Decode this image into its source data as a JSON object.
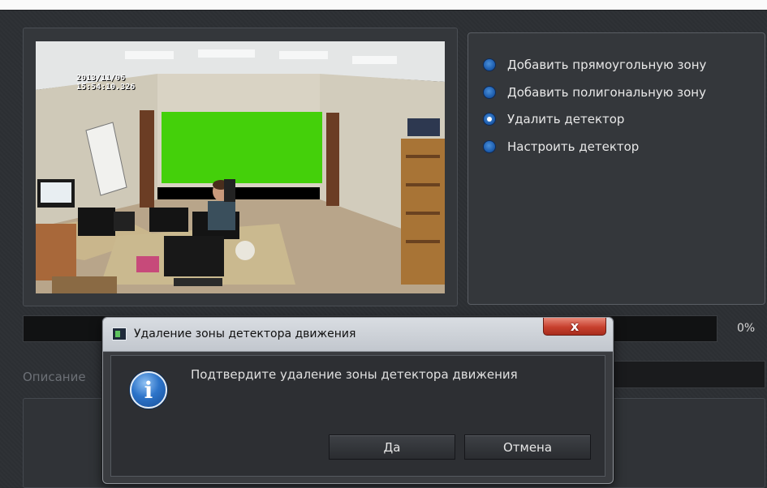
{
  "video": {
    "timestamp_date": "2013/11/06",
    "timestamp_time": "15:54:10.326"
  },
  "options": [
    {
      "label": "Добавить прямоугольную зону",
      "checked": false
    },
    {
      "label": "Добавить полигональную зону",
      "checked": false
    },
    {
      "label": "Удалить детектор",
      "checked": true
    },
    {
      "label": "Настроить детектор",
      "checked": false
    }
  ],
  "progress": {
    "value": 0,
    "label": "0%"
  },
  "description": {
    "label": "Описание"
  },
  "dialog": {
    "title": "Удаление зоны детектора движения",
    "close_label": "x",
    "message": "Подтвердите удаление зоны детектора движения",
    "icon": "info-icon",
    "ok_label": "Да",
    "cancel_label": "Отмена"
  },
  "colors": {
    "background": "#2f3236",
    "accent": "#1f5fb0",
    "zone": "#3cd000",
    "close": "#c7402e"
  }
}
